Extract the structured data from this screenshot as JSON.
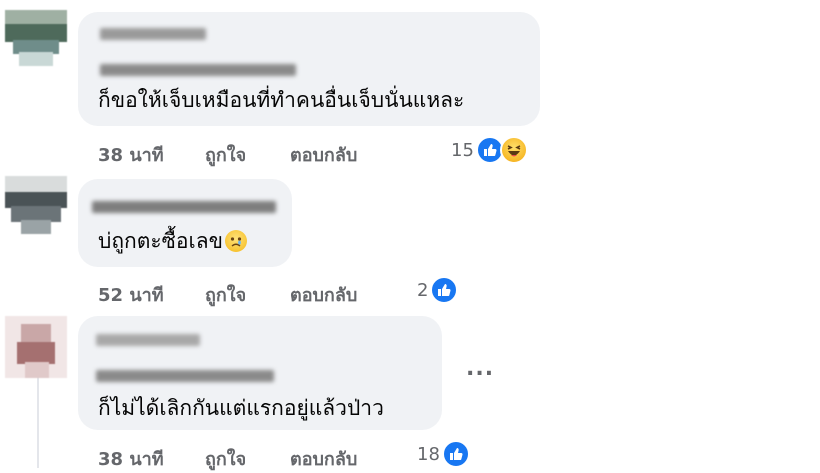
{
  "comments": [
    {
      "text": "ก็ขอให้เจ็บเหมือนที่ทำคนอื่นเจ็บนั่นแหละ",
      "time": "38 นาที",
      "like_label": "ถูกใจ",
      "reply_label": "ตอบกลับ",
      "reaction_count": "15",
      "reactions": [
        "like-icon",
        "haha-icon"
      ]
    },
    {
      "text": "บ่ถูกตะซื้อเลข",
      "emoji": "sad-face-icon",
      "time": "52 นาที",
      "like_label": "ถูกใจ",
      "reply_label": "ตอบกลับ",
      "reaction_count": "2",
      "reactions": [
        "like-icon"
      ]
    },
    {
      "text": "ก็ไม่ได้เลิกกันแต่แรกอยู่แล้วป่าว",
      "time": "38 นาที",
      "like_label": "ถูกใจ",
      "reply_label": "ตอบกลับ",
      "reaction_count": "18",
      "reactions": [
        "like-icon"
      ]
    }
  ],
  "more_options": "...",
  "colors": {
    "bubble": "#f0f2f5",
    "secondary_text": "#65676b",
    "like_blue": "#1877f2"
  }
}
